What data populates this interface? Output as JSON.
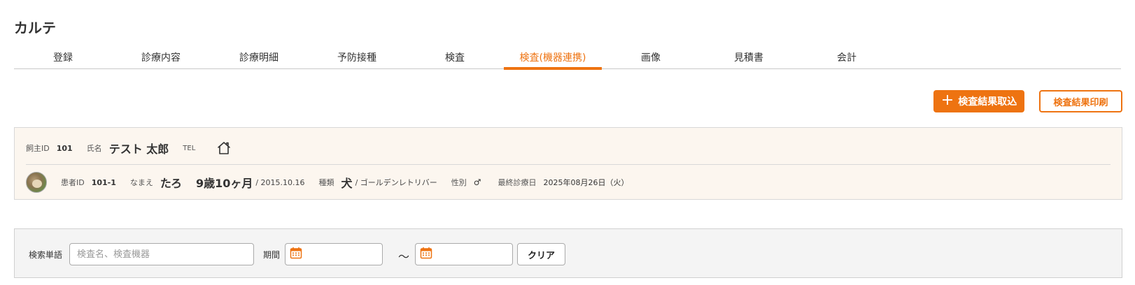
{
  "page": {
    "title": "カルテ"
  },
  "tabs": [
    {
      "label": "登録",
      "active": false
    },
    {
      "label": "診療内容",
      "active": false
    },
    {
      "label": "診療明細",
      "active": false
    },
    {
      "label": "予防接種",
      "active": false
    },
    {
      "label": "検査",
      "active": false
    },
    {
      "label": "検査(機器連携)",
      "active": true
    },
    {
      "label": "画像",
      "active": false
    },
    {
      "label": "見積書",
      "active": false
    },
    {
      "label": "会計",
      "active": false
    }
  ],
  "actions": {
    "import_label": "検査結果取込",
    "import_icon": "plus-icon",
    "print_label": "検査結果印刷"
  },
  "owner": {
    "id_label": "飼主ID",
    "id": "101",
    "name_label": "氏名",
    "name": "テスト 太郎",
    "tel_label": "TEL",
    "home_icon": "home-icon"
  },
  "patient": {
    "id_label": "患者ID",
    "id": "101-1",
    "name_label": "なまえ",
    "name": "たろ",
    "age": "9歳10ヶ月",
    "birthdate": "/ 2015.10.16",
    "species_label": "種類",
    "species": "犬",
    "breed": "/ ゴールデンレトリバー",
    "sex_label": "性別",
    "sex": "♂",
    "last_visit_label": "最終診療日",
    "last_visit": "2025年08月26日（火）"
  },
  "search": {
    "keyword_label": "検索単語",
    "keyword_placeholder": "検査名、検査機器",
    "keyword_value": "",
    "period_label": "期間",
    "date_from": "",
    "date_to": "",
    "tilde": "～",
    "calendar_icon": "calendar-icon",
    "clear_label": "クリア"
  },
  "colors": {
    "accent": "#ee7311",
    "panel_bg": "#fcf6ef",
    "search_bg": "#f4f4f4"
  }
}
